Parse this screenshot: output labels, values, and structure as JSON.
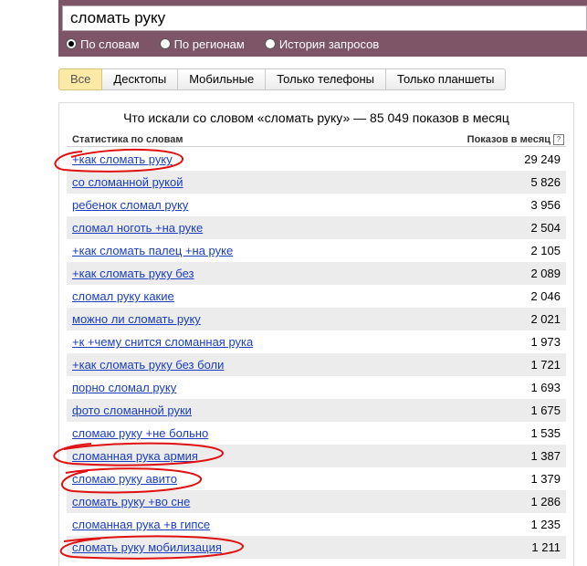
{
  "search": {
    "value": "сломать руку"
  },
  "modes": [
    {
      "label": "По словам",
      "checked": true
    },
    {
      "label": "По регионам",
      "checked": false
    },
    {
      "label": "История запросов",
      "checked": false
    }
  ],
  "tabs": [
    {
      "label": "Все",
      "active": true
    },
    {
      "label": "Десктопы",
      "active": false
    },
    {
      "label": "Мобильные",
      "active": false
    },
    {
      "label": "Только телефоны",
      "active": false
    },
    {
      "label": "Только планшеты",
      "active": false
    }
  ],
  "panel": {
    "title": "Что искали со словом «сломать руку» — 85 049 показов в месяц",
    "col_left": "Статистика по словам",
    "col_right": "Показов в месяц",
    "help": "?"
  },
  "rows": [
    {
      "query": "+как сломать руку",
      "count": "29 249"
    },
    {
      "query": "со сломанной рукой",
      "count": "5 826"
    },
    {
      "query": "ребенок сломал руку",
      "count": "3 956"
    },
    {
      "query": "сломал ноготь +на руке",
      "count": "2 504"
    },
    {
      "query": "+как сломать палец +на руке",
      "count": "2 105"
    },
    {
      "query": "+как сломать руку без",
      "count": "2 089"
    },
    {
      "query": "сломал руку какие",
      "count": "2 046"
    },
    {
      "query": "можно ли сломать руку",
      "count": "2 021"
    },
    {
      "query": "+к +чему снится сломанная рука",
      "count": "1 973"
    },
    {
      "query": "+как сломать руку без боли",
      "count": "1 721"
    },
    {
      "query": "порно сломал руку",
      "count": "1 693"
    },
    {
      "query": "фото сломанной руки",
      "count": "1 675"
    },
    {
      "query": "сломаю руку +не больно",
      "count": "1 535"
    },
    {
      "query": "сломанная рука армия",
      "count": "1 387"
    },
    {
      "query": "сломаю руку авито",
      "count": "1 379"
    },
    {
      "query": "сломать руку +во сне",
      "count": "1 286"
    },
    {
      "query": "сломанная рука +в гипсе",
      "count": "1 235"
    },
    {
      "query": "сломать руку мобилизация",
      "count": "1 211"
    }
  ],
  "colors": {
    "header": "#7e5566",
    "link": "#1a3dc1",
    "annotation": "#e01010",
    "active_tab": "#fbe9a5"
  }
}
